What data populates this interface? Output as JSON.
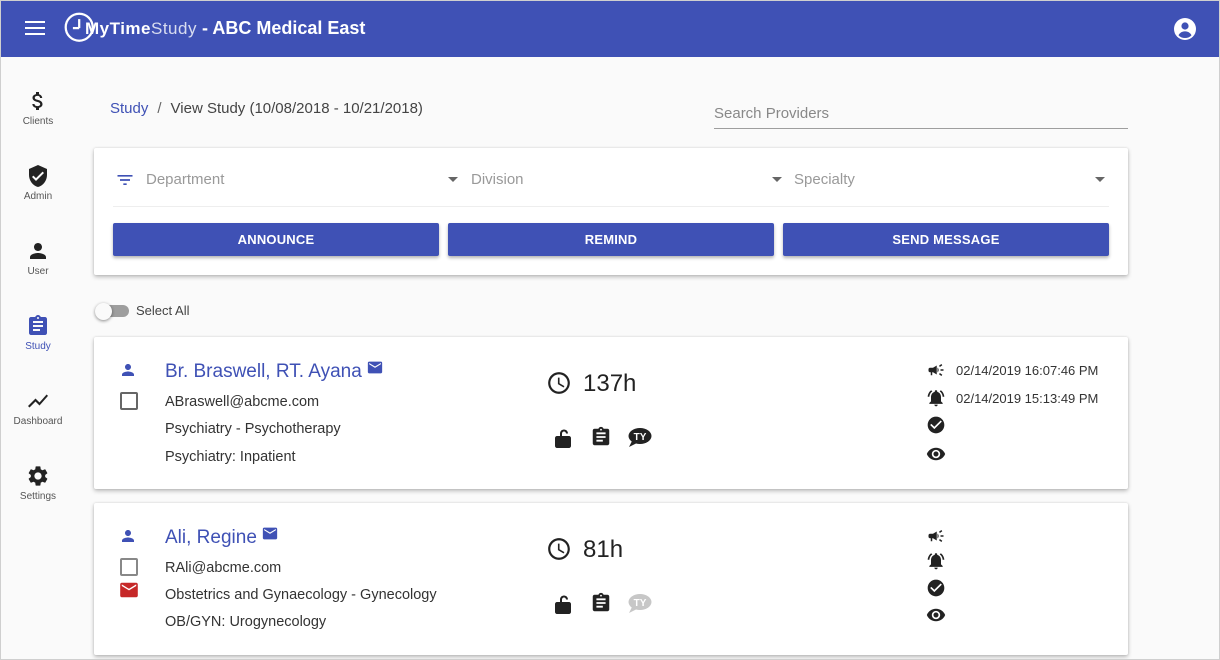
{
  "header": {
    "logo_text_primary": "MyTime",
    "logo_text_secondary": "Study",
    "title": "- ABC Medical East"
  },
  "sidebar": {
    "items": [
      {
        "label": "Clients",
        "icon": "dollar-icon"
      },
      {
        "label": "Admin",
        "icon": "shield-check-icon"
      },
      {
        "label": "User",
        "icon": "person-icon"
      },
      {
        "label": "Study",
        "icon": "clipboard-icon",
        "active": true
      },
      {
        "label": "Dashboard",
        "icon": "trending-icon"
      },
      {
        "label": "Settings",
        "icon": "gear-icon"
      }
    ]
  },
  "breadcrumb": {
    "link": "Study",
    "separator": "/",
    "current": "View Study (10/08/2018 - 10/21/2018)"
  },
  "search": {
    "placeholder": "Search Providers",
    "value": ""
  },
  "filters": {
    "department": "Department",
    "division": "Division",
    "specialty": "Specialty"
  },
  "actions": {
    "announce": "ANNOUNCE",
    "remind": "REMIND",
    "send_message": "SEND MESSAGE"
  },
  "select_all": {
    "label": "Select All",
    "checked": false
  },
  "providers": [
    {
      "name": "Br. Braswell, RT. Ayana",
      "email": "ABraswell@abcme.com",
      "department": "Psychiatry - Psychotherapy",
      "specialty": "Psychiatry: Inpatient",
      "hours": "137h",
      "announced": "02/14/2019 16:07:46 PM",
      "reminded": "02/14/2019 15:13:49 PM",
      "ty_active": true,
      "has_unread_mail": false
    },
    {
      "name": "Ali, Regine",
      "email": "RAli@abcme.com",
      "department": "Obstetrics and Gynaecology - Gynecology",
      "specialty": "OB/GYN: Urogynecology",
      "hours": "81h",
      "announced": "",
      "reminded": "",
      "ty_active": false,
      "has_unread_mail": true
    }
  ],
  "colors": {
    "primary": "#3f51b5",
    "mail_flag": "#c62828",
    "ty_inactive": "#bdbdbd"
  }
}
